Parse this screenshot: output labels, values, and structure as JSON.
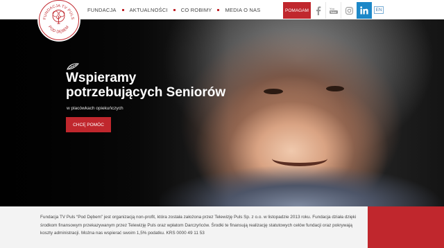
{
  "logo": {
    "text_top": "FUNDACJA TV PULS",
    "text_bottom": "POD DĘBEM"
  },
  "nav": {
    "items": [
      "FUNDACJA",
      "AKTUALNOŚCI",
      "CO ROBIMY",
      "MEDIA O NAS"
    ]
  },
  "header": {
    "help_label": "POMAGAM",
    "lang_label": "EN",
    "social": [
      "facebook-icon",
      "youtube-icon",
      "instagram-icon",
      "linkedin-icon"
    ]
  },
  "hero": {
    "title_line1": "Wspieramy",
    "title_line2": "potrzebujących Seniorów",
    "subtitle": "w placówkach opiekuńczych",
    "cta_label": "CHCĘ POMÓC"
  },
  "about": {
    "text": "Fundacja TV Puls “Pod Dębem” jest organizacją non-profit, która została założona przez Telewizję Puls Sp. z o.o. w listopadzie 2013 roku. Fundacja działa dzięki środkom finansowym przekazywanym przez Telewizję Puls oraz wpłatom Darczyńców. Środki te finansują realizację statutowych celów fundacji oraz pokrywają koszty administracji. Można nas wspierać swoim 1,5% podatku. KRS 0000 49 11 53"
  },
  "colors": {
    "accent": "#c0272d",
    "linkedin": "#1d88c8"
  }
}
